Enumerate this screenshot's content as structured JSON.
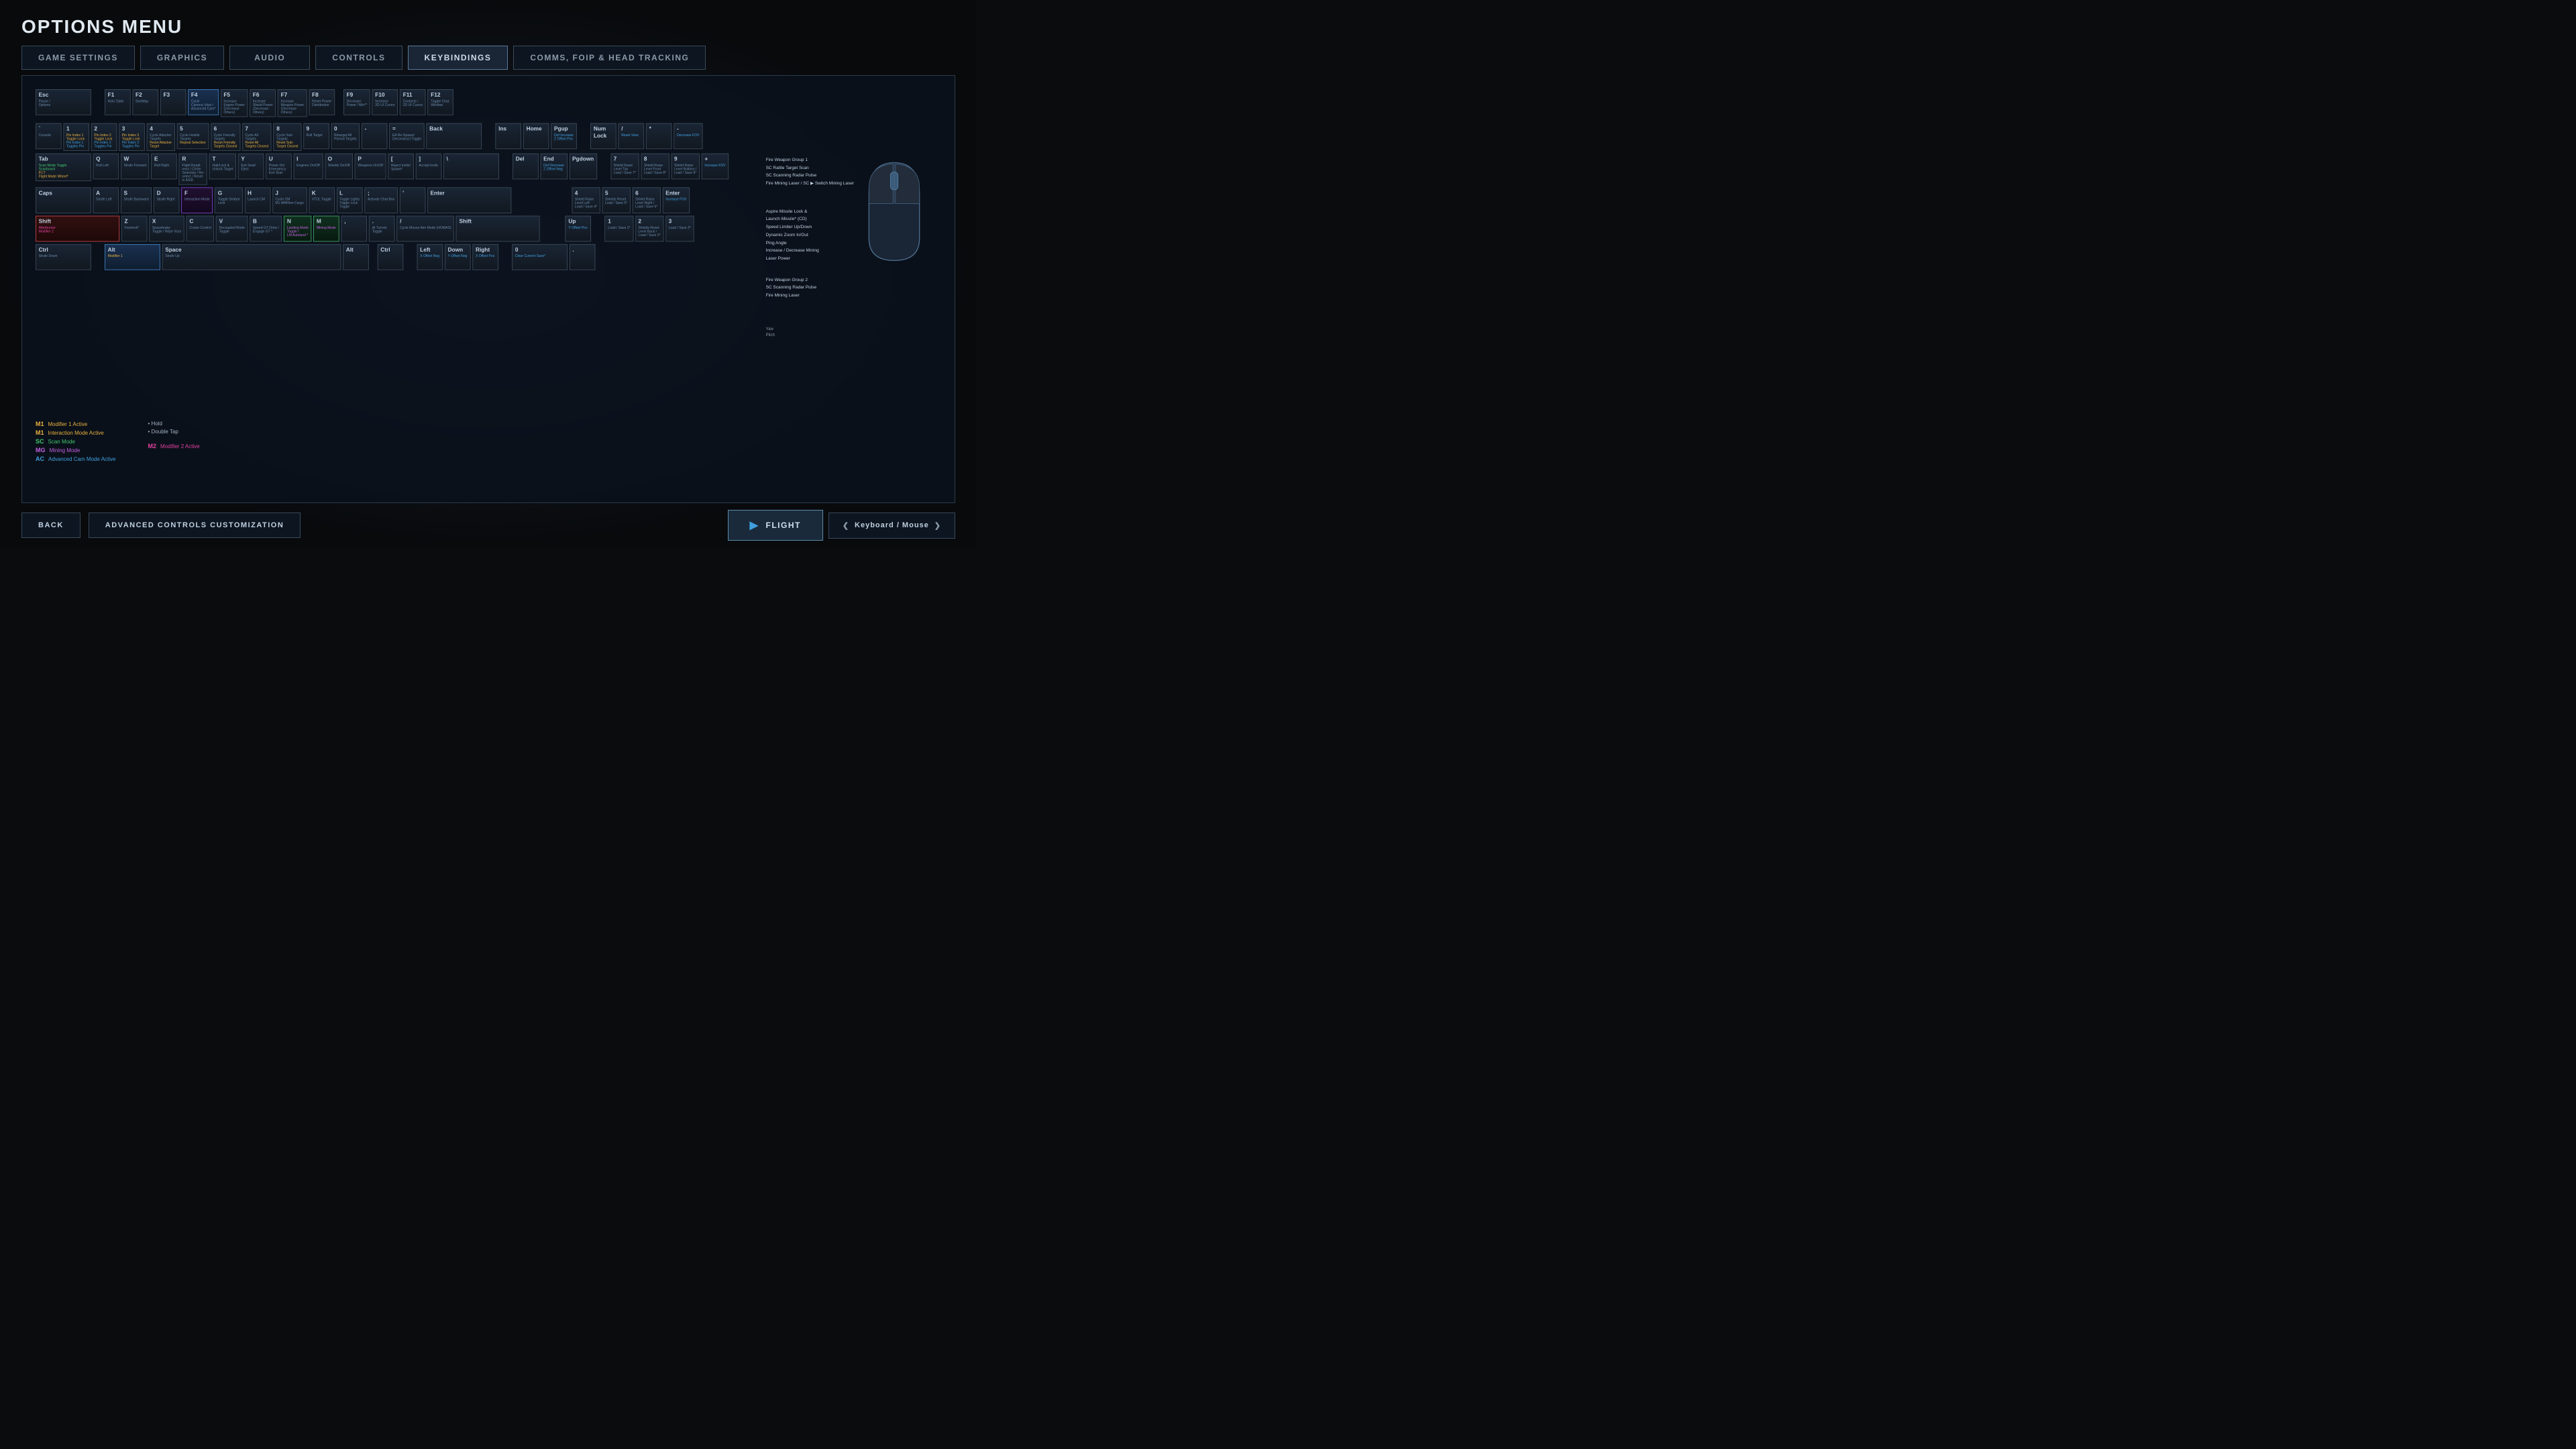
{
  "page": {
    "title": "OPTIONS MENU"
  },
  "nav": {
    "tabs": [
      {
        "id": "game-settings",
        "label": "GAME SETTINGS",
        "active": false
      },
      {
        "id": "graphics",
        "label": "GRAPHICS",
        "active": false
      },
      {
        "id": "audio",
        "label": "AUDIO",
        "active": false
      },
      {
        "id": "controls",
        "label": "CONTROLS",
        "active": false
      },
      {
        "id": "keybindings",
        "label": "KEYBINDINGS",
        "active": true
      },
      {
        "id": "comms",
        "label": "COMMS, FOIP & HEAD TRACKING",
        "active": false
      }
    ]
  },
  "legend": {
    "items": [
      {
        "id": "m1",
        "color": "#e8b040",
        "label": "M1  Modifier 1 Active"
      },
      {
        "id": "m1i",
        "color": "#e8b040",
        "label": "M1  Interaction Mode Active"
      },
      {
        "id": "sc",
        "color": "#40c870",
        "label": "SC  Scan Mode"
      },
      {
        "id": "mg",
        "color": "#c060e0",
        "label": "MG  Mining Mode"
      },
      {
        "id": "ac",
        "color": "#40a0e0",
        "label": "AC  Advanced Cam Mode Active"
      }
    ],
    "hold_label": "•  Hold",
    "doubletap_label": "•  Double Tap",
    "m2_label": "M2  Modifier 2 Active"
  },
  "bottom": {
    "back_label": "BACK",
    "advanced_label": "ADVANCED CONTROLS CUSTOMIZATION",
    "flight_label": "FLIGHT",
    "controller_label": "Keyboard / Mouse"
  }
}
